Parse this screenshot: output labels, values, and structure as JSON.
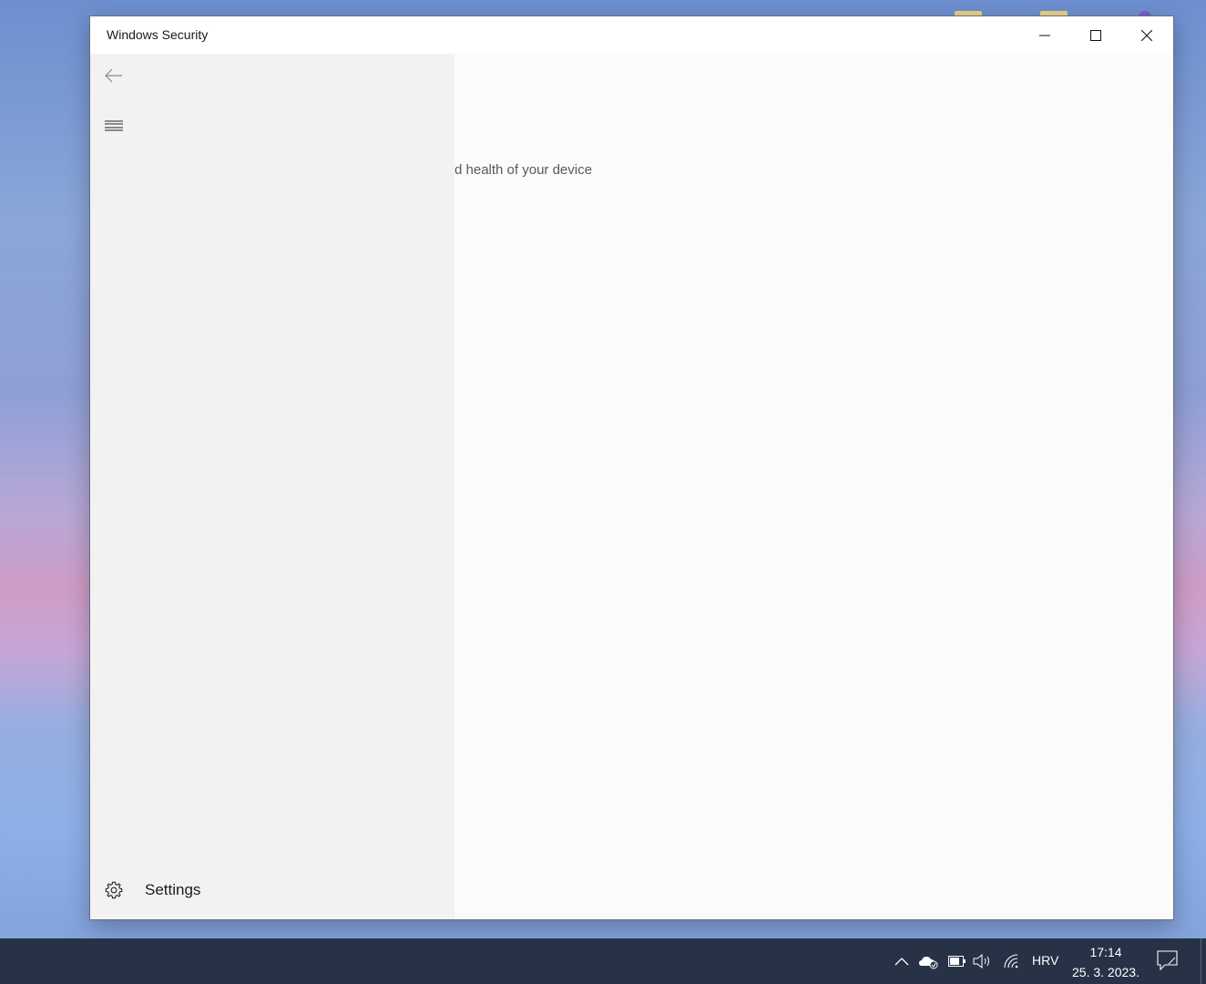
{
  "window": {
    "title": "Windows Security"
  },
  "sidebar": {
    "back_icon": "arrow-left-icon",
    "menu_icon": "hamburger-icon",
    "settings_label": "Settings",
    "settings_icon": "gear-icon"
  },
  "content": {
    "subtitle_fragment": "d health of your device"
  },
  "taskbar": {
    "language": "HRV",
    "time": "17:14",
    "date": "25. 3. 2023.",
    "tray_icons": [
      "chevron-up-icon",
      "onedrive-icon",
      "battery-icon",
      "volume-icon",
      "wifi-icon",
      "notification-icon"
    ]
  },
  "colors": {
    "taskbar_bg": "#273247",
    "sidebar_bg": "#f2f2f2",
    "content_bg": "#fbfbfb"
  }
}
